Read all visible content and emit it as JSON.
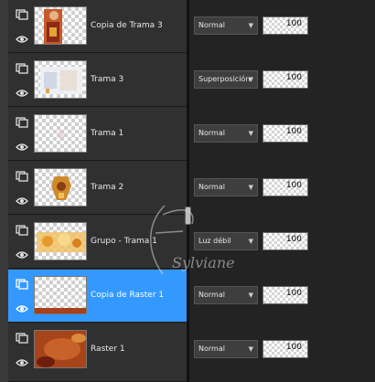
{
  "layers": [
    {
      "name": "Copia de Trama 3",
      "blend": "Normal",
      "opacity": "100",
      "selected": false,
      "thumb": "portrait"
    },
    {
      "name": "Trama 3",
      "blend": "Superposición",
      "opacity": "100",
      "selected": false,
      "thumb": "pale"
    },
    {
      "name": "Trama 1",
      "blend": "Normal",
      "opacity": "100",
      "selected": false,
      "thumb": "faint"
    },
    {
      "name": "Trama 2",
      "blend": "Normal",
      "opacity": "100",
      "selected": false,
      "thumb": "ornament"
    },
    {
      "name": "Grupo - Trama 1",
      "blend": "Luz débil",
      "opacity": "100",
      "selected": false,
      "thumb": "golden"
    },
    {
      "name": "Copia de Raster 1",
      "blend": "Normal",
      "opacity": "100",
      "selected": true,
      "thumb": "strip"
    },
    {
      "name": "Raster 1",
      "blend": "Normal",
      "opacity": "100",
      "selected": false,
      "thumb": "rust"
    }
  ],
  "watermark_text": "Sylviane",
  "colors": {
    "selection": "#3399ff",
    "panel": "#303030",
    "props_bg": "#232323"
  }
}
